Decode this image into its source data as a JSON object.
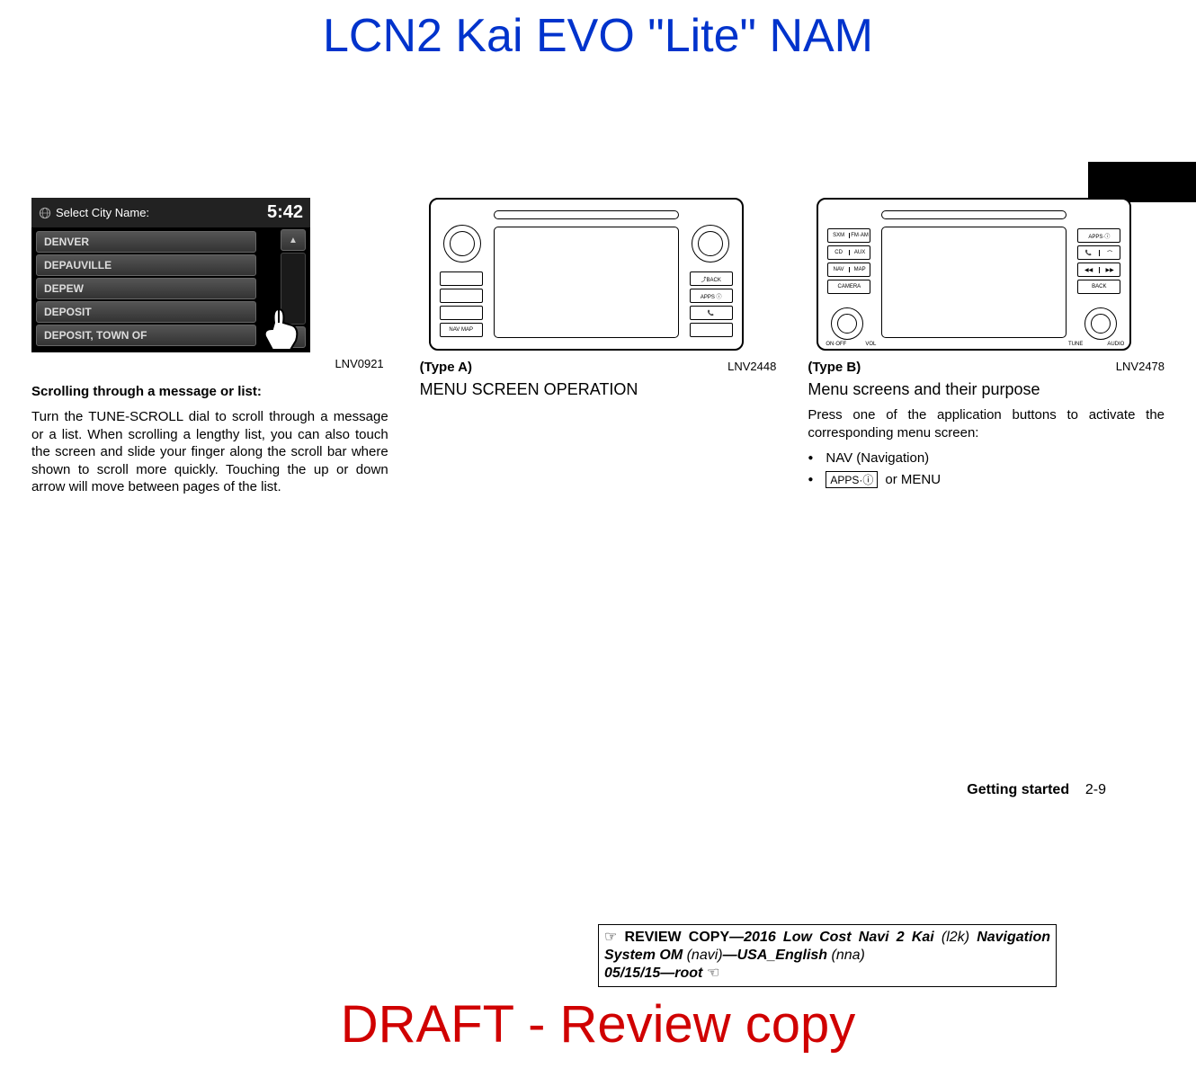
{
  "header": {
    "title": "LCN2 Kai EVO \"Lite\" NAM"
  },
  "figures": {
    "fig1": {
      "caption_code": "LNV0921",
      "screenshot": {
        "title": "Select City Name:",
        "time": "5:42",
        "rows": [
          "DENVER",
          "DEPAUVILLE",
          "DEPEW",
          "DEPOSIT",
          "DEPOSIT, TOWN OF"
        ],
        "scroll_up": "▲",
        "scroll_down": "▼"
      }
    },
    "fig2": {
      "type_label": "(Type A)",
      "caption_code": "LNV2448",
      "buttons": {
        "nav_map": "NAV MAP",
        "back": "⤴BACK",
        "apps": "APPS ⓘ",
        "phone": "📞"
      }
    },
    "fig3": {
      "type_label": "(Type B)",
      "caption_code": "LNV2478",
      "buttons": {
        "sxm": "SXM",
        "fmam": "FM·AM",
        "cd": "CD",
        "aux": "AUX",
        "nav": "NAV",
        "map": "MAP",
        "camera": "CAMERA",
        "apps": "APPS·ⓘ",
        "phone_up": "📞",
        "phone_down": "⌒",
        "prev": "◀◀",
        "next": "▶▶",
        "back": "BACK",
        "knob_left_l": "ON·OFF",
        "knob_left_r": "VOL",
        "knob_right_l": "TUNE",
        "knob_right_r": "AUDIO"
      }
    }
  },
  "col1": {
    "subheading": "Scrolling through a message or list:",
    "body": "Turn the TUNE-SCROLL dial to scroll through a message or a list. When scrolling a lengthy list, you can also touch the screen and slide your finger along the scroll bar where shown to scroll more quickly. Touching the up or down arrow will move between pages of the list."
  },
  "col2": {
    "heading": "MENU SCREEN OPERATION"
  },
  "col3": {
    "heading": "Menu screens and their purpose",
    "body": "Press one of the application buttons to activate the corresponding menu screen:",
    "bullets": {
      "b1": "NAV (Navigation)",
      "b2_prefix": "APPS·ⓘ",
      "b2_suffix": "or MENU"
    }
  },
  "footer": {
    "section": "Getting started",
    "page": "2-9"
  },
  "review_box": {
    "prefix": "☞ ",
    "line1_bold": "REVIEW COPY—",
    "line1_ital": "2016 Low Cost Navi 2 Kai ",
    "line1_paren": "(l2k)",
    "line2_bold": "Navigation System OM ",
    "line2_ital": "(navi)",
    "line2_bold2": "—USA_English",
    "line3_ital": "(nna)",
    "line4": "05/15/15—root ",
    "line4_suffix": "☜"
  },
  "watermark": "DRAFT - Review copy"
}
